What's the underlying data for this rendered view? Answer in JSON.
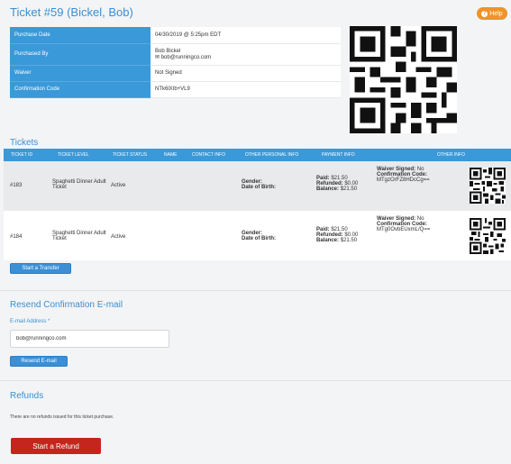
{
  "header": {
    "title": "Ticket #59 (Bickel, Bob)",
    "help_label": "Help"
  },
  "purchase_info": {
    "rows": [
      {
        "label": "Purchase Date",
        "value": "04/30/2019 @ 5:25pm EDT"
      },
      {
        "label": "Purchased By",
        "value": "Bob Bickel",
        "value2": "bob@runningco.com"
      },
      {
        "label": "Waiver",
        "value": "Not Signed"
      },
      {
        "label": "Confirmation Code",
        "value": "NTk6lXIb+VL9"
      }
    ]
  },
  "tickets": {
    "heading": "Tickets",
    "columns": [
      "Ticket ID",
      "Ticket Level",
      "Ticket Status",
      "Name",
      "Contact Info",
      "Other Personal Info",
      "Payment Info",
      "Other Info"
    ],
    "rows": [
      {
        "id": "#183",
        "level": "Spaghetti Dinner Adult Ticket",
        "status": "Active",
        "gender_label": "Gender:",
        "dob_label": "Date of Birth:",
        "paid_label": "Paid:",
        "paid": "$21.50",
        "refunded_label": "Refunded:",
        "refunded": "$0.00",
        "balance_label": "Balance:",
        "balance": "$21.50",
        "waiver_label": "Waiver Signed:",
        "waiver": "No",
        "conf_label": "Confirmation Code:",
        "conf": "MTgzOrFZ8HDcCg=="
      },
      {
        "id": "#184",
        "level": "Spaghetti Dinner Adult Ticket",
        "status": "Active",
        "gender_label": "Gender:",
        "dob_label": "Date of Birth:",
        "paid_label": "Paid:",
        "paid": "$21.50",
        "refunded_label": "Refunded:",
        "refunded": "$0.00",
        "balance_label": "Balance:",
        "balance": "$21.50",
        "waiver_label": "Waiver Signed:",
        "waiver": "No",
        "conf_label": "Confirmation Code:",
        "conf": "MTg0OvbEUxmL/Q=="
      }
    ],
    "transfer_button": "Start a Transfer"
  },
  "resend": {
    "heading": "Resend Confirmation E-mail",
    "email_label": "E-mail Address *",
    "email_value": "bob@runningco.com",
    "button": "Resend E-mail"
  },
  "refunds": {
    "heading": "Refunds",
    "message": "There are no refunds issued for this ticket purchase.",
    "button": "Start a Refund"
  },
  "colors": {
    "accent": "#3a99d8",
    "help": "#f0932b",
    "danger": "#c4261e"
  }
}
